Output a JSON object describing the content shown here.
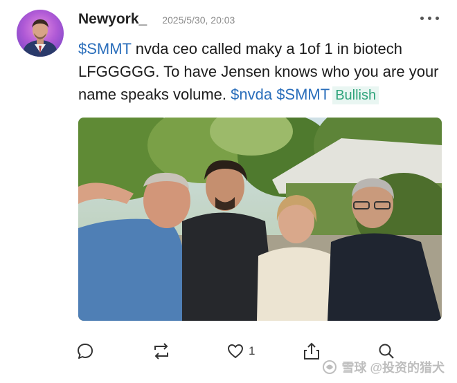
{
  "post": {
    "username": "Newyork_",
    "timestamp": "2025/5/30, 20:03",
    "more_icon": "more-horizontal-icon",
    "content": {
      "tag_smmt_1": "$SMMT",
      "text_1": " nvda ceo called maky a 1of 1 in biotech LFGGGGG. To have Jensen knows who you are your name speaks volume. ",
      "tag_nvda": "$nvda",
      "tag_smmt_2": "$SMMT",
      "sentiment": "Bullish"
    }
  },
  "actions": {
    "comment_icon": "comment-icon",
    "repost_icon": "repost-icon",
    "like_icon": "heart-icon",
    "like_count": "1",
    "share_icon": "share-icon",
    "search_icon": "search-icon"
  },
  "watermark": {
    "text": "雪球 @投资的猎犬"
  },
  "colors": {
    "link": "#2a6ebb",
    "bullish_text": "#2ea37a",
    "bullish_bg": "#e9f6f2"
  }
}
